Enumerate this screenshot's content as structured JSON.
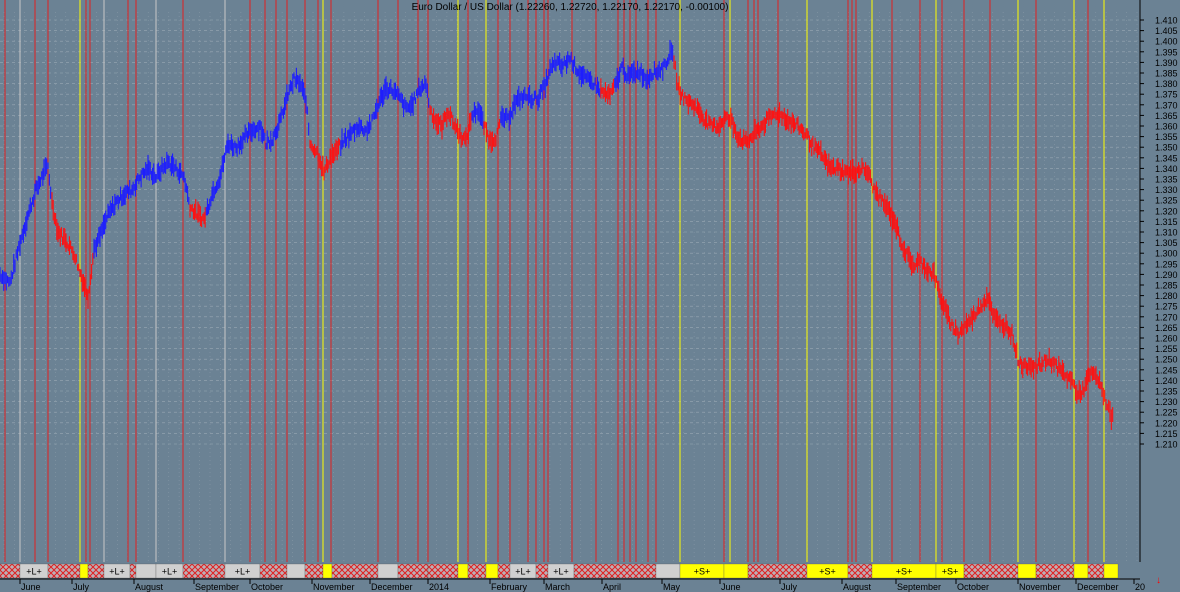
{
  "chart_data": {
    "type": "line",
    "title": "Euro Dollar / US Dollar (1.22260, 1.22720, 1.22170, 1.22170, -0.00100)",
    "ylim": [
      1.205,
      1.415
    ],
    "y_ticks": [
      "1.410",
      "1.405",
      "1.400",
      "1.395",
      "1.390",
      "1.385",
      "1.380",
      "1.375",
      "1.370",
      "1.365",
      "1.360",
      "1.355",
      "1.350",
      "1.345",
      "1.340",
      "1.335",
      "1.330",
      "1.325",
      "1.320",
      "1.315",
      "1.310",
      "1.305",
      "1.300",
      "1.295",
      "1.290",
      "1.285",
      "1.280",
      "1.275",
      "1.270",
      "1.265",
      "1.260",
      "1.255",
      "1.250",
      "1.245",
      "1.240",
      "1.235",
      "1.230",
      "1.225",
      "1.220",
      "1.215",
      "1.210"
    ],
    "x_ticks": [
      "June",
      "July",
      "August",
      "September",
      "October",
      "November",
      "December",
      "2014",
      "February",
      "March",
      "April",
      "May",
      "June",
      "July",
      "August",
      "September",
      "October",
      "November",
      "December",
      "20"
    ],
    "grid": true,
    "colors": {
      "background": "#6b8294",
      "up_trend": "#1c1cff",
      "down_trend": "#ff1010",
      "signal_red": "#e02020",
      "signal_yellow": "#ffff00",
      "signal_white": "#c8c8c8",
      "band_hatch": "#e02020",
      "band_white": "#d0d0d0",
      "band_yellow": "#ffff00"
    },
    "series": [
      {
        "color": "blue-red by trend",
        "points": [
          [
            0,
            1.29
          ],
          [
            10,
            1.286
          ],
          [
            20,
            1.305
          ],
          [
            28,
            1.318
          ],
          [
            36,
            1.33
          ],
          [
            44,
            1.338
          ],
          [
            48,
            1.341
          ],
          [
            52,
            1.324
          ],
          [
            58,
            1.31
          ],
          [
            66,
            1.306
          ],
          [
            74,
            1.3
          ],
          [
            80,
            1.291
          ],
          [
            88,
            1.28
          ],
          [
            94,
            1.302
          ],
          [
            100,
            1.308
          ],
          [
            108,
            1.318
          ],
          [
            116,
            1.324
          ],
          [
            124,
            1.328
          ],
          [
            132,
            1.33
          ],
          [
            140,
            1.336
          ],
          [
            148,
            1.34
          ],
          [
            156,
            1.336
          ],
          [
            162,
            1.34
          ],
          [
            168,
            1.343
          ],
          [
            176,
            1.34
          ],
          [
            184,
            1.336
          ],
          [
            190,
            1.322
          ],
          [
            198,
            1.318
          ],
          [
            204,
            1.316
          ],
          [
            212,
            1.328
          ],
          [
            220,
            1.336
          ],
          [
            228,
            1.352
          ],
          [
            236,
            1.35
          ],
          [
            244,
            1.354
          ],
          [
            252,
            1.358
          ],
          [
            260,
            1.36
          ],
          [
            266,
            1.352
          ],
          [
            272,
            1.354
          ],
          [
            280,
            1.362
          ],
          [
            288,
            1.375
          ],
          [
            294,
            1.382
          ],
          [
            300,
            1.38
          ],
          [
            306,
            1.372
          ],
          [
            310,
            1.352
          ],
          [
            318,
            1.347
          ],
          [
            324,
            1.338
          ],
          [
            330,
            1.345
          ],
          [
            336,
            1.348
          ],
          [
            342,
            1.352
          ],
          [
            350,
            1.356
          ],
          [
            358,
            1.36
          ],
          [
            366,
            1.358
          ],
          [
            372,
            1.362
          ],
          [
            378,
            1.37
          ],
          [
            386,
            1.378
          ],
          [
            392,
            1.377
          ],
          [
            400,
            1.373
          ],
          [
            406,
            1.368
          ],
          [
            412,
            1.37
          ],
          [
            420,
            1.378
          ],
          [
            426,
            1.38
          ],
          [
            430,
            1.368
          ],
          [
            436,
            1.362
          ],
          [
            442,
            1.36
          ],
          [
            448,
            1.367
          ],
          [
            454,
            1.361
          ],
          [
            460,
            1.356
          ],
          [
            466,
            1.353
          ],
          [
            472,
            1.365
          ],
          [
            478,
            1.368
          ],
          [
            484,
            1.36
          ],
          [
            490,
            1.353
          ],
          [
            496,
            1.355
          ],
          [
            502,
            1.364
          ],
          [
            508,
            1.363
          ],
          [
            514,
            1.37
          ],
          [
            520,
            1.373
          ],
          [
            526,
            1.374
          ],
          [
            532,
            1.373
          ],
          [
            538,
            1.373
          ],
          [
            544,
            1.378
          ],
          [
            550,
            1.386
          ],
          [
            556,
            1.39
          ],
          [
            562,
            1.388
          ],
          [
            570,
            1.392
          ],
          [
            578,
            1.386
          ],
          [
            586,
            1.382
          ],
          [
            594,
            1.38
          ],
          [
            602,
            1.376
          ],
          [
            610,
            1.374
          ],
          [
            616,
            1.38
          ],
          [
            622,
            1.388
          ],
          [
            628,
            1.383
          ],
          [
            634,
            1.385
          ],
          [
            640,
            1.386
          ],
          [
            646,
            1.382
          ],
          [
            652,
            1.385
          ],
          [
            658,
            1.386
          ],
          [
            664,
            1.388
          ],
          [
            670,
            1.394
          ],
          [
            674,
            1.392
          ],
          [
            678,
            1.378
          ],
          [
            686,
            1.372
          ],
          [
            694,
            1.37
          ],
          [
            702,
            1.365
          ],
          [
            710,
            1.36
          ],
          [
            718,
            1.36
          ],
          [
            726,
            1.364
          ],
          [
            732,
            1.362
          ],
          [
            738,
            1.355
          ],
          [
            746,
            1.352
          ],
          [
            754,
            1.356
          ],
          [
            762,
            1.36
          ],
          [
            770,
            1.364
          ],
          [
            776,
            1.366
          ],
          [
            782,
            1.365
          ],
          [
            790,
            1.362
          ],
          [
            798,
            1.36
          ],
          [
            806,
            1.356
          ],
          [
            814,
            1.35
          ],
          [
            822,
            1.346
          ],
          [
            830,
            1.34
          ],
          [
            838,
            1.34
          ],
          [
            846,
            1.338
          ],
          [
            854,
            1.338
          ],
          [
            862,
            1.34
          ],
          [
            868,
            1.338
          ],
          [
            874,
            1.33
          ],
          [
            880,
            1.326
          ],
          [
            886,
            1.322
          ],
          [
            894,
            1.316
          ],
          [
            902,
            1.304
          ],
          [
            908,
            1.298
          ],
          [
            914,
            1.294
          ],
          [
            920,
            1.296
          ],
          [
            928,
            1.292
          ],
          [
            934,
            1.29
          ],
          [
            940,
            1.28
          ],
          [
            946,
            1.272
          ],
          [
            952,
            1.266
          ],
          [
            958,
            1.262
          ],
          [
            964,
            1.265
          ],
          [
            970,
            1.268
          ],
          [
            976,
            1.272
          ],
          [
            982,
            1.276
          ],
          [
            988,
            1.28
          ],
          [
            994,
            1.27
          ],
          [
            1000,
            1.266
          ],
          [
            1006,
            1.266
          ],
          [
            1012,
            1.262
          ],
          [
            1018,
            1.25
          ],
          [
            1024,
            1.246
          ],
          [
            1030,
            1.248
          ],
          [
            1036,
            1.246
          ],
          [
            1042,
            1.248
          ],
          [
            1048,
            1.25
          ],
          [
            1054,
            1.248
          ],
          [
            1060,
            1.245
          ],
          [
            1066,
            1.242
          ],
          [
            1072,
            1.24
          ],
          [
            1078,
            1.233
          ],
          [
            1084,
            1.236
          ],
          [
            1090,
            1.243
          ],
          [
            1096,
            1.242
          ],
          [
            1102,
            1.236
          ],
          [
            1106,
            1.23
          ],
          [
            1110,
            1.224
          ],
          [
            1114,
            1.222
          ]
        ]
      }
    ],
    "down_ranges": [
      [
        52,
        94
      ],
      [
        190,
        206
      ],
      [
        310,
        340
      ],
      [
        430,
        472
      ],
      [
        484,
        500
      ],
      [
        600,
        614
      ],
      [
        674,
        1114
      ]
    ],
    "signal_lines": [
      {
        "x": 5,
        "c": "red"
      },
      {
        "x": 20,
        "c": "white"
      },
      {
        "x": 35,
        "c": "red"
      },
      {
        "x": 48,
        "c": "red"
      },
      {
        "x": 80,
        "c": "yellow"
      },
      {
        "x": 86,
        "c": "red"
      },
      {
        "x": 90,
        "c": "red"
      },
      {
        "x": 104,
        "c": "white"
      },
      {
        "x": 128,
        "c": "red"
      },
      {
        "x": 136,
        "c": "red"
      },
      {
        "x": 156,
        "c": "white"
      },
      {
        "x": 183,
        "c": "red"
      },
      {
        "x": 225,
        "c": "white"
      },
      {
        "x": 250,
        "c": "red"
      },
      {
        "x": 265,
        "c": "red"
      },
      {
        "x": 276,
        "c": "red"
      },
      {
        "x": 287,
        "c": "red"
      },
      {
        "x": 305,
        "c": "red"
      },
      {
        "x": 318,
        "c": "red"
      },
      {
        "x": 323,
        "c": "yellow"
      },
      {
        "x": 331,
        "c": "red"
      },
      {
        "x": 378,
        "c": "red"
      },
      {
        "x": 398,
        "c": "red"
      },
      {
        "x": 418,
        "c": "red"
      },
      {
        "x": 428,
        "c": "red"
      },
      {
        "x": 458,
        "c": "yellow"
      },
      {
        "x": 468,
        "c": "red"
      },
      {
        "x": 486,
        "c": "yellow"
      },
      {
        "x": 498,
        "c": "red"
      },
      {
        "x": 510,
        "c": "red"
      },
      {
        "x": 528,
        "c": "red"
      },
      {
        "x": 536,
        "c": "red"
      },
      {
        "x": 544,
        "c": "red"
      },
      {
        "x": 548,
        "c": "red"
      },
      {
        "x": 572,
        "c": "red"
      },
      {
        "x": 596,
        "c": "red"
      },
      {
        "x": 618,
        "c": "red"
      },
      {
        "x": 624,
        "c": "red"
      },
      {
        "x": 630,
        "c": "red"
      },
      {
        "x": 636,
        "c": "red"
      },
      {
        "x": 648,
        "c": "red"
      },
      {
        "x": 656,
        "c": "red"
      },
      {
        "x": 680,
        "c": "yellow"
      },
      {
        "x": 724,
        "c": "red"
      },
      {
        "x": 730,
        "c": "yellow"
      },
      {
        "x": 748,
        "c": "red"
      },
      {
        "x": 754,
        "c": "red"
      },
      {
        "x": 758,
        "c": "red"
      },
      {
        "x": 778,
        "c": "red"
      },
      {
        "x": 807,
        "c": "yellow"
      },
      {
        "x": 848,
        "c": "red"
      },
      {
        "x": 852,
        "c": "red"
      },
      {
        "x": 856,
        "c": "red"
      },
      {
        "x": 872,
        "c": "yellow"
      },
      {
        "x": 892,
        "c": "red"
      },
      {
        "x": 920,
        "c": "red"
      },
      {
        "x": 936,
        "c": "yellow"
      },
      {
        "x": 942,
        "c": "red"
      },
      {
        "x": 964,
        "c": "red"
      },
      {
        "x": 990,
        "c": "red"
      },
      {
        "x": 1018,
        "c": "yellow"
      },
      {
        "x": 1036,
        "c": "red"
      },
      {
        "x": 1074,
        "c": "yellow"
      },
      {
        "x": 1088,
        "c": "red"
      },
      {
        "x": 1104,
        "c": "yellow"
      }
    ],
    "band_segments": [
      {
        "x0": 0,
        "x1": 20,
        "k": "h"
      },
      {
        "x0": 20,
        "x1": 48,
        "k": "w",
        "label": "+L+"
      },
      {
        "x0": 48,
        "x1": 80,
        "k": "h"
      },
      {
        "x0": 80,
        "x1": 88,
        "k": "y"
      },
      {
        "x0": 88,
        "x1": 104,
        "k": "h"
      },
      {
        "x0": 104,
        "x1": 130,
        "k": "w",
        "label": "+L+"
      },
      {
        "x0": 130,
        "x1": 136,
        "k": "h"
      },
      {
        "x0": 136,
        "x1": 156,
        "k": "w"
      },
      {
        "x0": 156,
        "x1": 183,
        "k": "w",
        "label": "+L+"
      },
      {
        "x0": 183,
        "x1": 225,
        "k": "h"
      },
      {
        "x0": 225,
        "x1": 260,
        "k": "w",
        "label": "+L+"
      },
      {
        "x0": 260,
        "x1": 287,
        "k": "h"
      },
      {
        "x0": 287,
        "x1": 305,
        "k": "w"
      },
      {
        "x0": 305,
        "x1": 323,
        "k": "h"
      },
      {
        "x0": 323,
        "x1": 332,
        "k": "y"
      },
      {
        "x0": 332,
        "x1": 378,
        "k": "h"
      },
      {
        "x0": 378,
        "x1": 398,
        "k": "w"
      },
      {
        "x0": 398,
        "x1": 428,
        "k": "h"
      },
      {
        "x0": 428,
        "x1": 458,
        "k": "h"
      },
      {
        "x0": 458,
        "x1": 468,
        "k": "y"
      },
      {
        "x0": 468,
        "x1": 486,
        "k": "h"
      },
      {
        "x0": 486,
        "x1": 498,
        "k": "y"
      },
      {
        "x0": 498,
        "x1": 510,
        "k": "h"
      },
      {
        "x0": 510,
        "x1": 536,
        "k": "w",
        "label": "+L+"
      },
      {
        "x0": 536,
        "x1": 548,
        "k": "h"
      },
      {
        "x0": 548,
        "x1": 574,
        "k": "w",
        "label": "+L+"
      },
      {
        "x0": 574,
        "x1": 656,
        "k": "h"
      },
      {
        "x0": 656,
        "x1": 680,
        "k": "w"
      },
      {
        "x0": 680,
        "x1": 724,
        "k": "y",
        "label": "+S+"
      },
      {
        "x0": 724,
        "x1": 748,
        "k": "y"
      },
      {
        "x0": 748,
        "x1": 807,
        "k": "h"
      },
      {
        "x0": 807,
        "x1": 848,
        "k": "y",
        "label": "+S+"
      },
      {
        "x0": 848,
        "x1": 872,
        "k": "h"
      },
      {
        "x0": 872,
        "x1": 936,
        "k": "y",
        "label": "+S+"
      },
      {
        "x0": 936,
        "x1": 964,
        "k": "y",
        "label": "+S+"
      },
      {
        "x0": 964,
        "x1": 1018,
        "k": "h"
      },
      {
        "x0": 1018,
        "x1": 1036,
        "k": "y"
      },
      {
        "x0": 1036,
        "x1": 1074,
        "k": "h"
      },
      {
        "x0": 1074,
        "x1": 1088,
        "k": "y"
      },
      {
        "x0": 1088,
        "x1": 1104,
        "k": "h"
      },
      {
        "x0": 1104,
        "x1": 1118,
        "k": "y"
      }
    ],
    "x_tick_positions": [
      20,
      72,
      134,
      194,
      250,
      312,
      370,
      428,
      490,
      544,
      602,
      662,
      720,
      780,
      842,
      896,
      956,
      1018,
      1076,
      1134
    ]
  },
  "sell_marker_icon": "red-down-arrow-icon",
  "sell_marker_glyph": "↓"
}
